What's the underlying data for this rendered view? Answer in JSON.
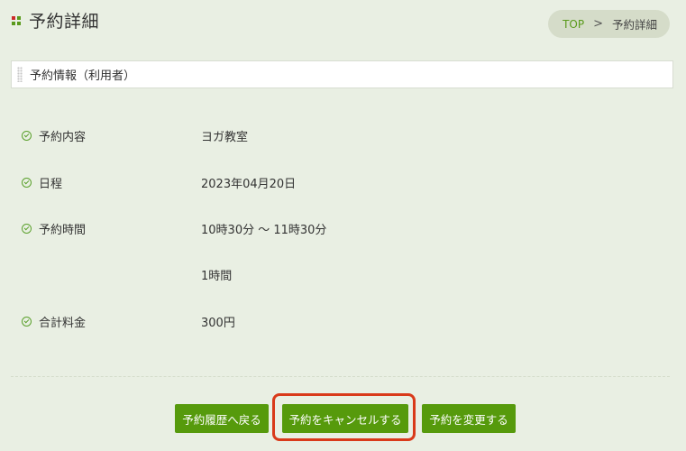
{
  "header": {
    "title": "予約詳細"
  },
  "breadcrumb": {
    "home": "TOP",
    "separator": ">",
    "current": "予約詳細"
  },
  "section": {
    "title": "予約情報（利用者）"
  },
  "details": [
    {
      "label": "予約内容",
      "value": "ヨガ教室"
    },
    {
      "label": "日程",
      "value": "2023年04月20日"
    },
    {
      "label": "予約時間",
      "value": "10時30分 ～ 11時30分"
    },
    {
      "label": "",
      "value": "1時間"
    },
    {
      "label": "合計料金",
      "value": "300円"
    }
  ],
  "buttons": {
    "back": "予約履歴へ戻る",
    "cancel": "予約をキャンセルする",
    "change": "予約を変更する"
  },
  "colors": {
    "accent": "#569a0c",
    "background": "#e9efe3",
    "highlight": "#d93a1a"
  },
  "icons": [
    "title-mark-icon",
    "chevron-right-icon",
    "grip-icon",
    "check-circle-icon"
  ]
}
